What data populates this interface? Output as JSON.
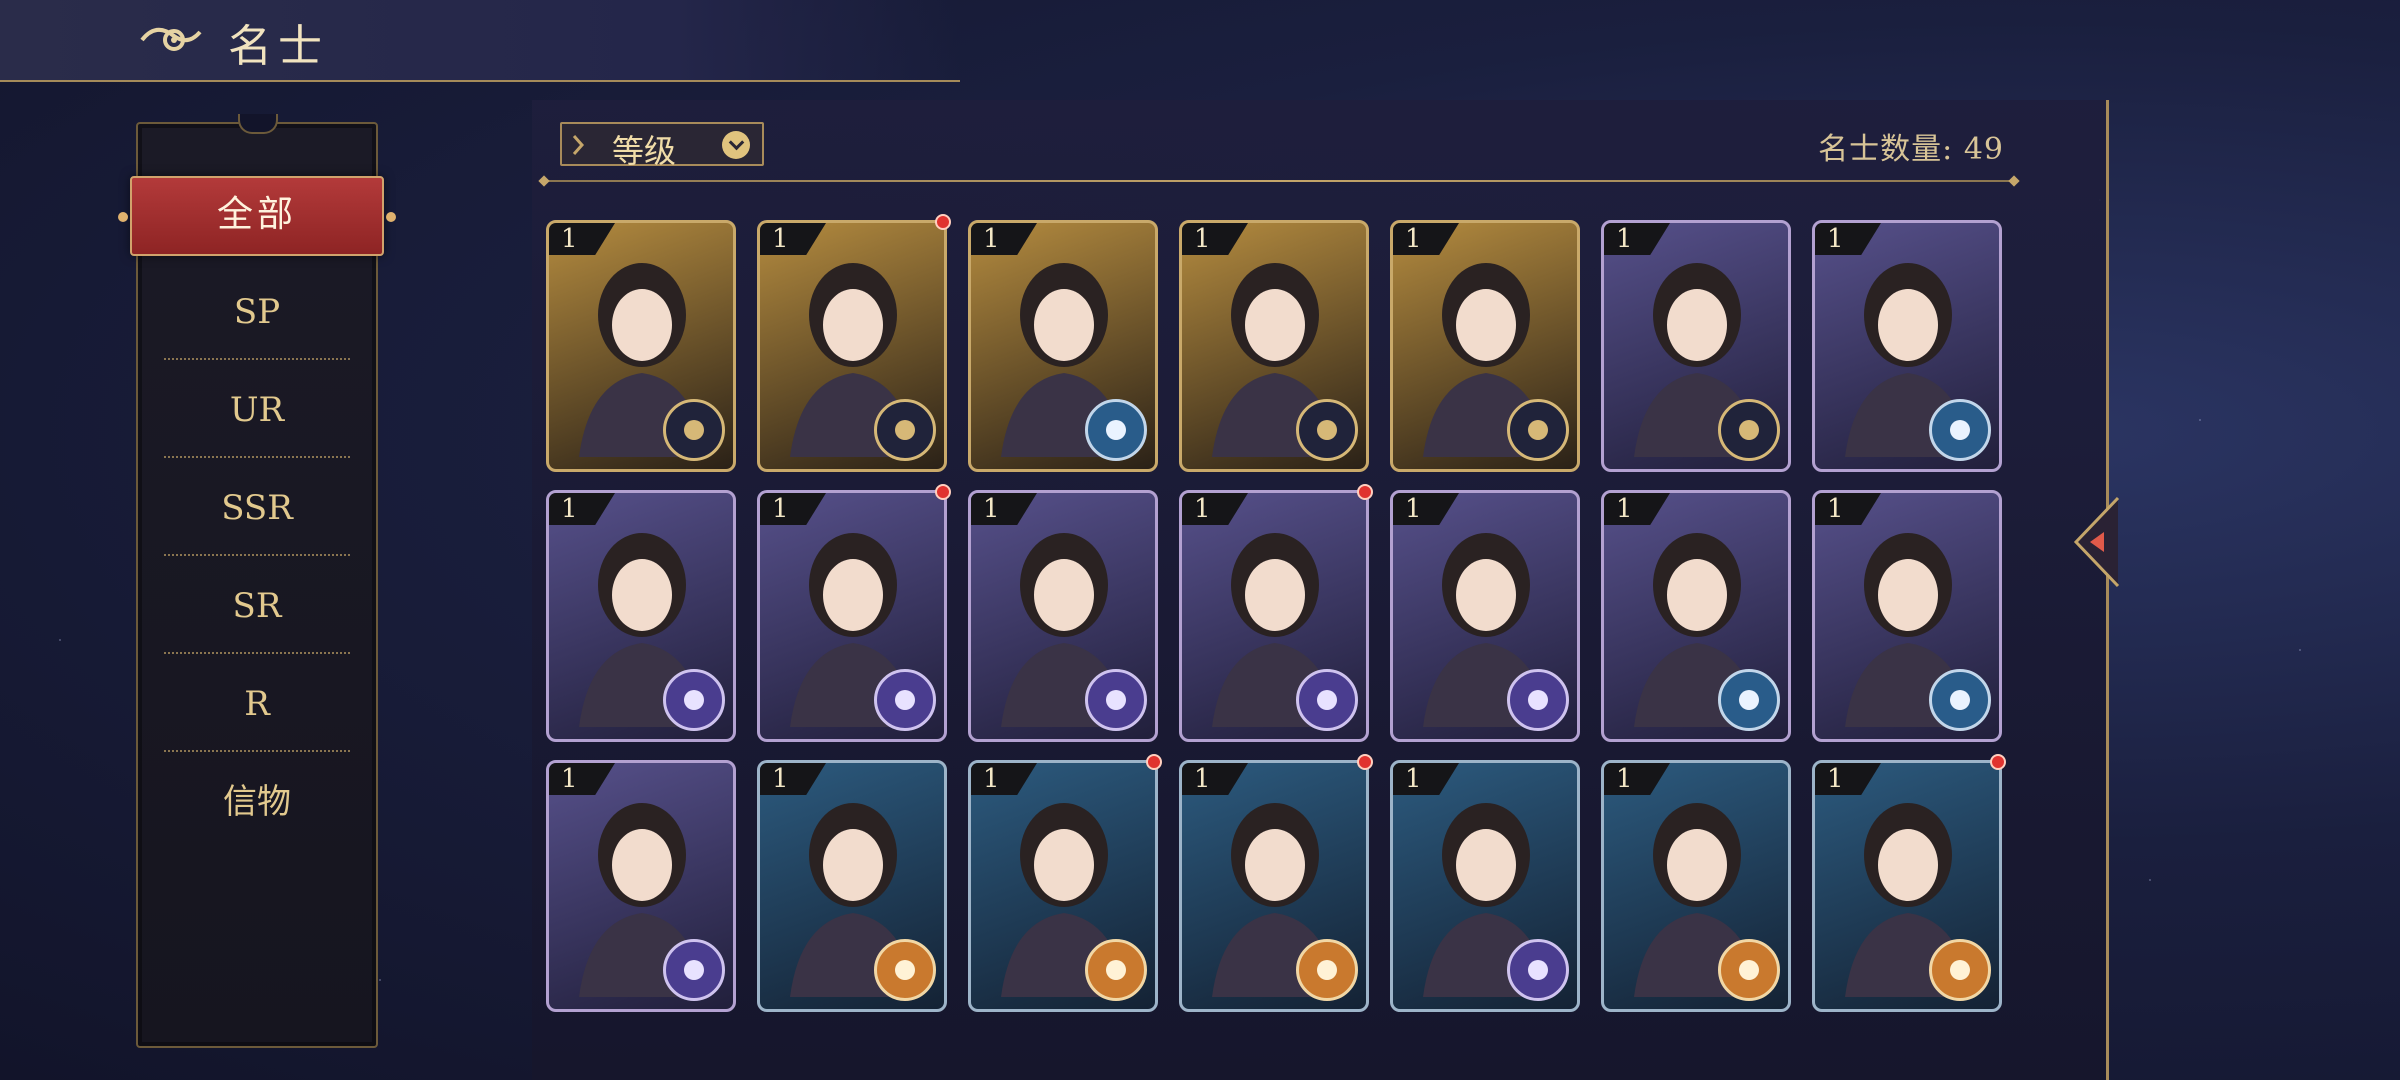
{
  "header": {
    "title": "名士",
    "icon": "cloud-emblem-icon"
  },
  "sidebar": {
    "active": "全部",
    "items": [
      {
        "label": "SP"
      },
      {
        "label": "UR"
      },
      {
        "label": "SSR"
      },
      {
        "label": "SR"
      },
      {
        "label": "R"
      },
      {
        "label": "信物"
      }
    ]
  },
  "toolbar": {
    "sort_label": "等级",
    "sort_icon": "chevron-down-icon"
  },
  "count_text": "名士数量: 49",
  "cards": [
    {
      "level": "1",
      "theme": "gold",
      "badge": "gold",
      "dot": false
    },
    {
      "level": "1",
      "theme": "gold",
      "badge": "gold",
      "dot": true
    },
    {
      "level": "1",
      "theme": "gold",
      "badge": "blue",
      "dot": false
    },
    {
      "level": "1",
      "theme": "gold",
      "badge": "gold",
      "dot": false
    },
    {
      "level": "1",
      "theme": "gold",
      "badge": "gold",
      "dot": false
    },
    {
      "level": "1",
      "theme": "purple",
      "badge": "gold",
      "dot": false
    },
    {
      "level": "1",
      "theme": "purple",
      "badge": "blue",
      "dot": false
    },
    {
      "level": "1",
      "theme": "purple",
      "badge": "purple",
      "dot": false
    },
    {
      "level": "1",
      "theme": "purple",
      "badge": "purple",
      "dot": true
    },
    {
      "level": "1",
      "theme": "purple",
      "badge": "purple",
      "dot": false
    },
    {
      "level": "1",
      "theme": "purple",
      "badge": "purple",
      "dot": true
    },
    {
      "level": "1",
      "theme": "purple",
      "badge": "purple",
      "dot": false
    },
    {
      "level": "1",
      "theme": "purple",
      "badge": "blue",
      "dot": false
    },
    {
      "level": "1",
      "theme": "purple",
      "badge": "blue",
      "dot": false
    },
    {
      "level": "1",
      "theme": "purple",
      "badge": "purple",
      "dot": false
    },
    {
      "level": "1",
      "theme": "blue",
      "badge": "orange",
      "dot": false
    },
    {
      "level": "1",
      "theme": "blue",
      "badge": "orange",
      "dot": true
    },
    {
      "level": "1",
      "theme": "blue",
      "badge": "orange",
      "dot": true
    },
    {
      "level": "1",
      "theme": "blue",
      "badge": "purple",
      "dot": false
    },
    {
      "level": "1",
      "theme": "blue",
      "badge": "orange",
      "dot": false
    },
    {
      "level": "1",
      "theme": "blue",
      "badge": "orange",
      "dot": true
    }
  ]
}
